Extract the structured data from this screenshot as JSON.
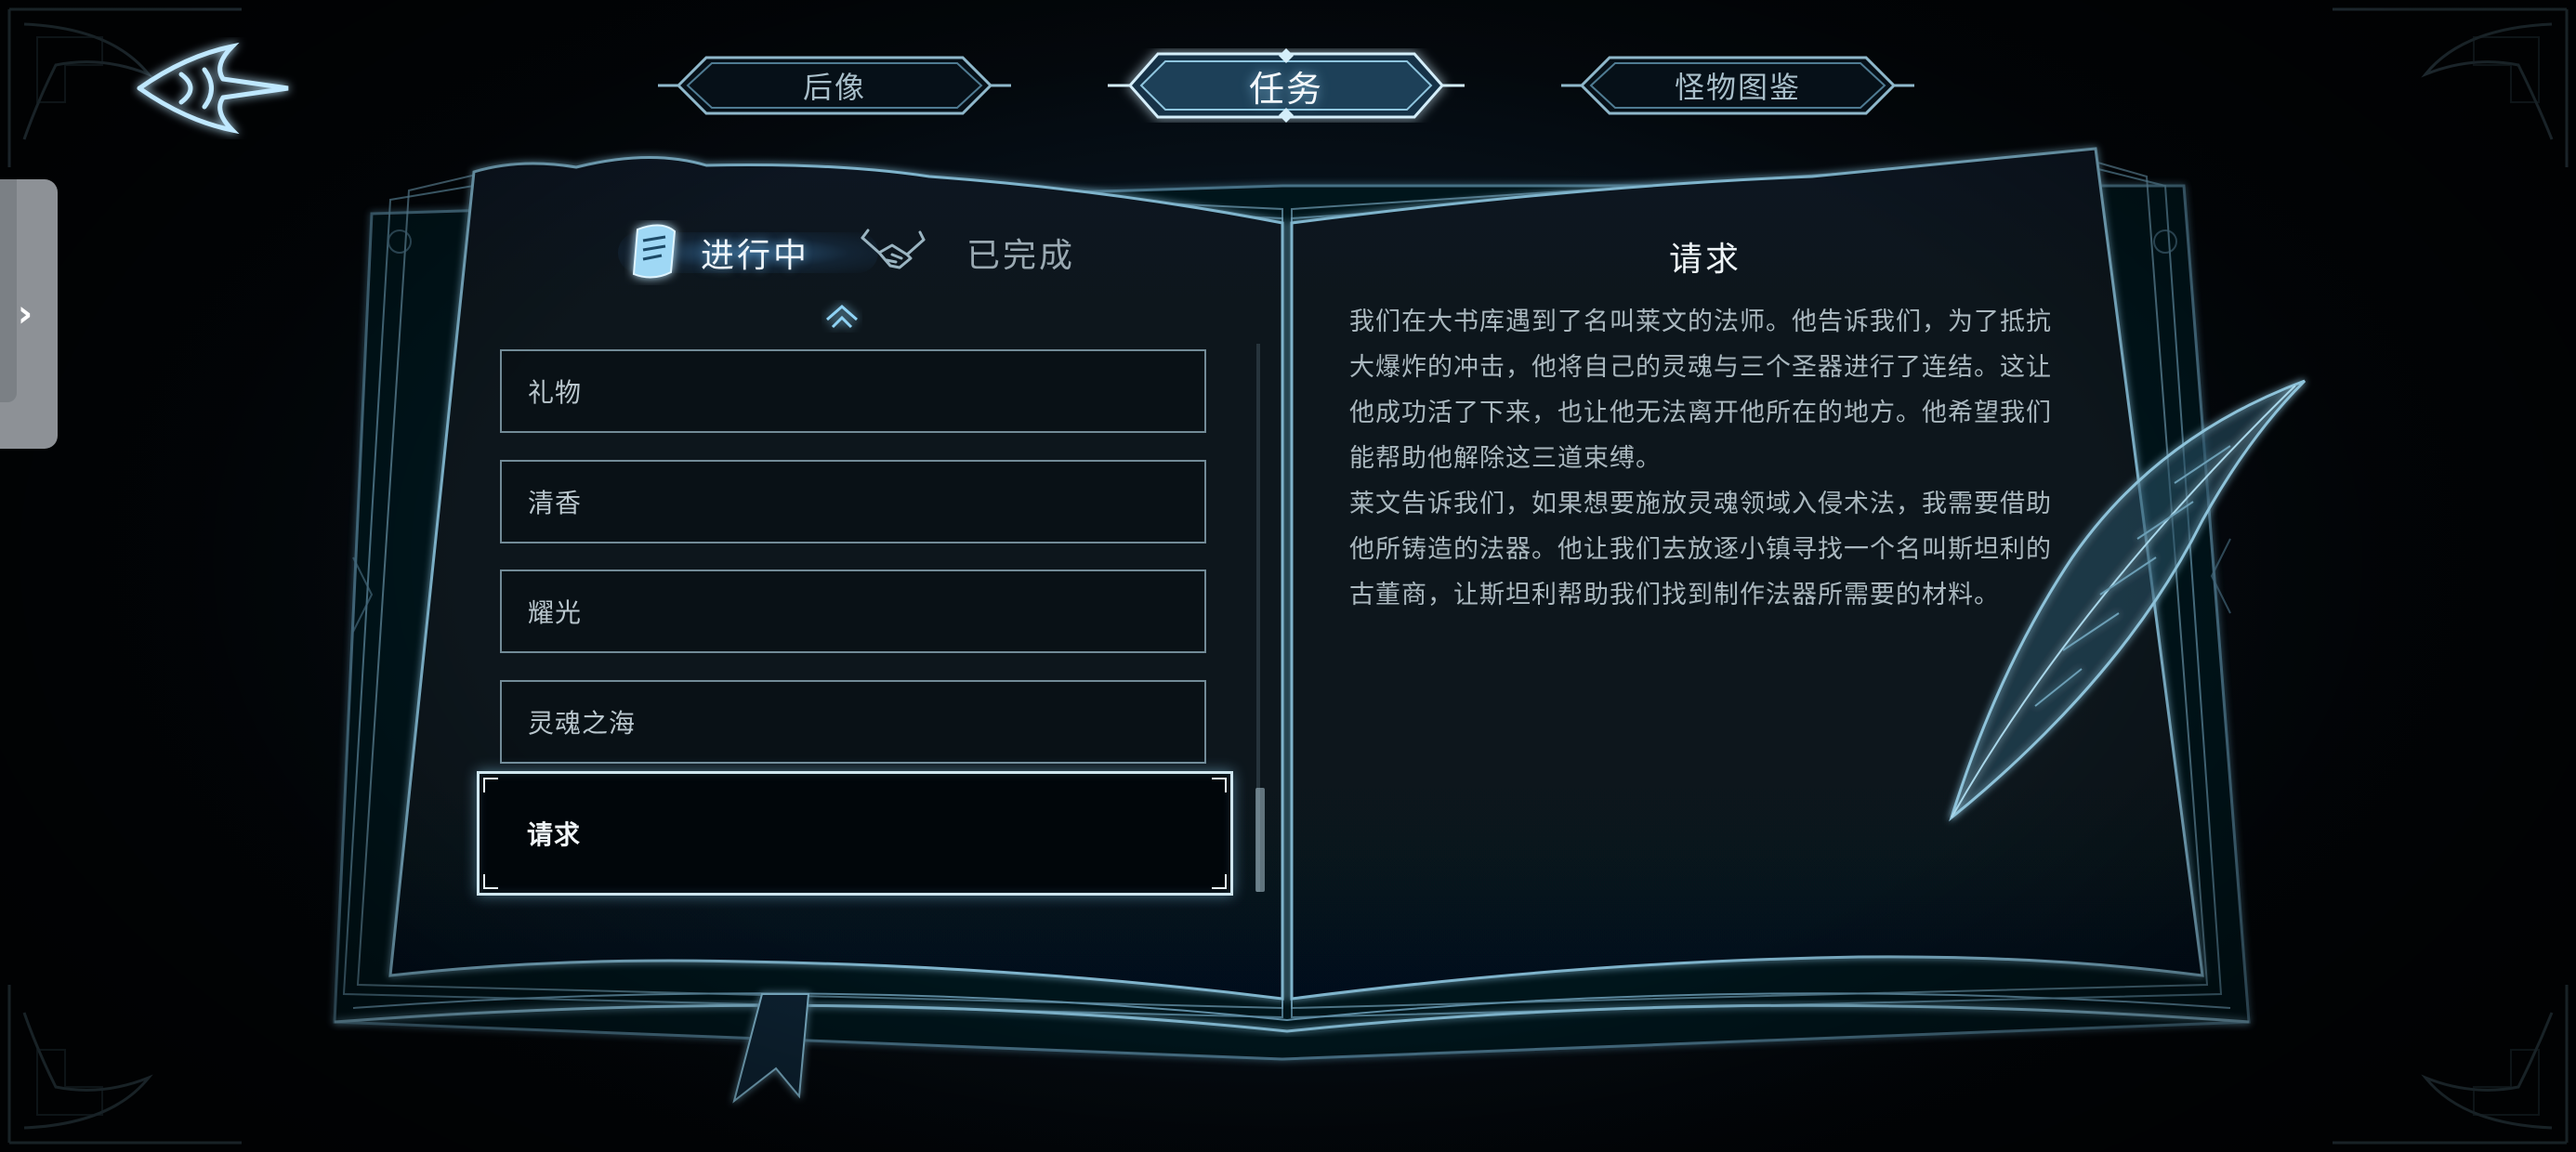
{
  "top_tabs": [
    {
      "label": "后像",
      "active": false
    },
    {
      "label": "任务",
      "active": true
    },
    {
      "label": "怪物图鉴",
      "active": false
    }
  ],
  "quest_tabs": {
    "in_progress_label": "进行中",
    "completed_label": "已完成",
    "active": "in_progress"
  },
  "quests": [
    {
      "title": "礼物"
    },
    {
      "title": "清香"
    },
    {
      "title": "耀光"
    },
    {
      "title": "灵魂之海"
    },
    {
      "title": "请求"
    }
  ],
  "selected_quest_index": 4,
  "detail": {
    "title": "请求",
    "paragraphs": [
      "我们在大书库遇到了名叫莱文的法师。他告诉我们，为了抵抗大爆炸的冲击，他将自己的灵魂与三个圣器进行了连结。这让他成功活了下来，也让他无法离开他所在的地方。他希望我们能帮助他解除这三道束缚。",
      "莱文告诉我们，如果想要施放灵魂领域入侵术法，我需要借助他所铸造的法器。他让我们去放逐小镇寻找一个名叫斯坦利的古董商，让斯坦利帮助我们找到制作法器所需要的材料。"
    ]
  },
  "icons": {
    "back": "back-emblem-icon",
    "side_handle": "chevron-right-icon",
    "in_progress": "scroll-icon",
    "completed": "handshake-icon",
    "scroll_up": "double-chevron-up-icon",
    "decoration": "quill-icon"
  },
  "colors": {
    "glow": "#7fd2ff",
    "page_line": "#6f9cb3",
    "background": "#050a10"
  }
}
